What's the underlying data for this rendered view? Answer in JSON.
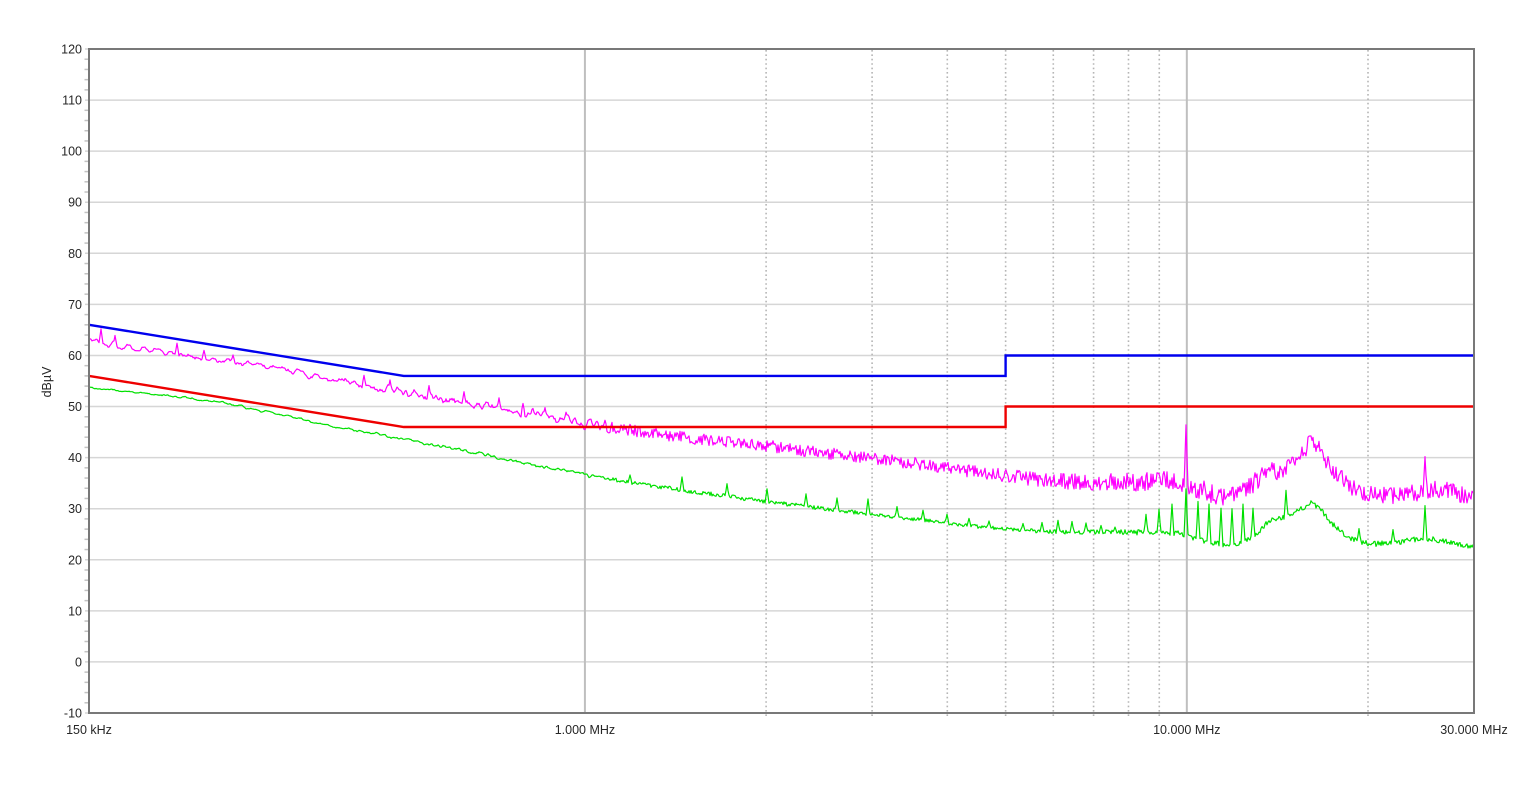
{
  "palette": {
    "background": "#ffffff",
    "plot_background": "#ffffff",
    "axis_border": "#787878",
    "grid_major_horizontal": "#d6d6d6",
    "grid_major_vertical": "#bfbfbf",
    "grid_minor_vertical": "#b5b5b5",
    "minor_tick": "#c3c3c3",
    "tick_text": "#262626",
    "limit_qp": "#0000ee",
    "limit_avg": "#ee0000",
    "trace_peak": "#ff00ff",
    "trace_avg": "#00e000"
  },
  "chart_data": {
    "type": "line",
    "title": "",
    "xlabel": "",
    "ylabel": "dBµV",
    "x_scale": "log",
    "x_unit": "MHz",
    "xlim": [
      0.15,
      30
    ],
    "ylim": [
      -10,
      120
    ],
    "y_major_step": 10,
    "y_minor_step": 2,
    "grid": true,
    "legend": "none",
    "y_ticks": [
      {
        "v": 120,
        "label": "120"
      },
      {
        "v": 110,
        "label": "110"
      },
      {
        "v": 100,
        "label": "100"
      },
      {
        "v": 90,
        "label": "90"
      },
      {
        "v": 80,
        "label": "80"
      },
      {
        "v": 70,
        "label": "70"
      },
      {
        "v": 60,
        "label": "60"
      },
      {
        "v": 50,
        "label": "50"
      },
      {
        "v": 40,
        "label": "40"
      },
      {
        "v": 30,
        "label": "30"
      },
      {
        "v": 20,
        "label": "20"
      },
      {
        "v": 10,
        "label": "10"
      },
      {
        "v": 0,
        "label": "0"
      },
      {
        "v": -10,
        "label": "-10"
      }
    ],
    "x_ticks": [
      {
        "v": 0.15,
        "label": "150 kHz"
      },
      {
        "v": 1,
        "label": "1.000 MHz"
      },
      {
        "v": 10,
        "label": "10.000 MHz"
      },
      {
        "v": 30,
        "label": "30.000 MHz"
      }
    ],
    "x_major_grid": [
      1,
      10
    ],
    "x_minor_grid": [
      2,
      3,
      4,
      5,
      6,
      7,
      8,
      9,
      20
    ],
    "series": [
      {
        "name": "limit-quasi-peak",
        "kind": "limit",
        "color": "#0000ee",
        "width": 2.4,
        "points": [
          [
            0.15,
            66
          ],
          [
            0.5,
            56
          ],
          [
            5,
            56
          ],
          [
            5,
            60
          ],
          [
            30,
            60
          ]
        ]
      },
      {
        "name": "limit-average",
        "kind": "limit",
        "color": "#ee0000",
        "width": 2.4,
        "points": [
          [
            0.15,
            56
          ],
          [
            0.5,
            46
          ],
          [
            5,
            46
          ],
          [
            5,
            50
          ],
          [
            30,
            50
          ]
        ]
      },
      {
        "name": "trace-peak",
        "kind": "noisy-trace",
        "color": "#ff00ff",
        "width": 1.2,
        "seed": 20,
        "baseline": [
          [
            0.15,
            63.3
          ],
          [
            0.16,
            62.3
          ],
          [
            0.18,
            61.3
          ],
          [
            0.2,
            60.6
          ],
          [
            0.23,
            59.6
          ],
          [
            0.26,
            58.8
          ],
          [
            0.3,
            57.6
          ],
          [
            0.34,
            56.4
          ],
          [
            0.4,
            54.8
          ],
          [
            0.45,
            53.8
          ],
          [
            0.5,
            52.8
          ],
          [
            0.6,
            51.2
          ],
          [
            0.7,
            49.9
          ],
          [
            0.8,
            48.7
          ],
          [
            0.9,
            47.6
          ],
          [
            1.0,
            46.6
          ],
          [
            1.2,
            45.3
          ],
          [
            1.5,
            43.8
          ],
          [
            2.0,
            42.2
          ],
          [
            2.5,
            40.9
          ],
          [
            3.0,
            39.9
          ],
          [
            3.5,
            38.9
          ],
          [
            4.0,
            38.0
          ],
          [
            4.5,
            37.2
          ],
          [
            5.0,
            36.5
          ],
          [
            5.5,
            35.9
          ],
          [
            6.0,
            35.4
          ],
          [
            7.0,
            35.2
          ],
          [
            8.0,
            35.3
          ],
          [
            9.0,
            35.5
          ],
          [
            9.8,
            35.2
          ],
          [
            10.5,
            33.8
          ],
          [
            11.0,
            33.0
          ],
          [
            11.6,
            32.4
          ],
          [
            12.2,
            32.8
          ],
          [
            12.8,
            34.5
          ],
          [
            13.4,
            36.8
          ],
          [
            13.9,
            37.4
          ],
          [
            14.3,
            37.2
          ],
          [
            15.0,
            38.8
          ],
          [
            15.6,
            41.0
          ],
          [
            16.1,
            43.3
          ],
          [
            16.6,
            42.0
          ],
          [
            17.2,
            38.8
          ],
          [
            17.8,
            36.5
          ],
          [
            18.5,
            34.8
          ],
          [
            19.5,
            33.5
          ],
          [
            20.5,
            32.9
          ],
          [
            22.0,
            32.6
          ],
          [
            24.0,
            33.2
          ],
          [
            26.0,
            33.8
          ],
          [
            27.5,
            33.3
          ],
          [
            29.0,
            32.8
          ],
          [
            30.0,
            32.2
          ]
        ],
        "noise_amp": [
          [
            0.15,
            0.7
          ],
          [
            0.3,
            0.7
          ],
          [
            0.5,
            0.9
          ],
          [
            1.0,
            1.1
          ],
          [
            2.0,
            1.1
          ],
          [
            4.0,
            1.2
          ],
          [
            6.0,
            1.5
          ],
          [
            8.0,
            1.9
          ],
          [
            12.0,
            1.9
          ],
          [
            16.0,
            1.7
          ],
          [
            30,
            1.8
          ]
        ],
        "spikes": [
          [
            0.157,
            65.2
          ],
          [
            0.166,
            63.9
          ],
          [
            0.21,
            62.4
          ],
          [
            0.233,
            61.0
          ],
          [
            0.26,
            60.1
          ],
          [
            0.43,
            56.1
          ],
          [
            0.475,
            55.2
          ],
          [
            0.55,
            54.1
          ],
          [
            0.63,
            52.9
          ],
          [
            0.72,
            51.7
          ],
          [
            0.79,
            50.6
          ],
          [
            0.86,
            49.8
          ],
          [
            0.93,
            48.9
          ],
          [
            1.08,
            47.3
          ],
          [
            1.19,
            46.5
          ],
          [
            1.31,
            45.7
          ],
          [
            1.46,
            45.0
          ],
          [
            1.62,
            44.3
          ],
          [
            1.8,
            43.7
          ],
          [
            2.05,
            43.3
          ],
          [
            2.35,
            42.3
          ],
          [
            2.62,
            41.6
          ],
          [
            2.95,
            40.8
          ],
          [
            3.3,
            39.8
          ],
          [
            3.65,
            39.0
          ],
          [
            4.0,
            38.6
          ],
          [
            9.95,
            46.4
          ],
          [
            13.0,
            37.0
          ],
          [
            24.85,
            40.2
          ]
        ]
      },
      {
        "name": "trace-average",
        "kind": "noisy-trace",
        "color": "#00e000",
        "width": 1.2,
        "seed": 99,
        "baseline": [
          [
            0.15,
            53.8
          ],
          [
            0.17,
            53.0
          ],
          [
            0.2,
            52.2
          ],
          [
            0.22,
            51.6
          ],
          [
            0.25,
            50.7
          ],
          [
            0.28,
            49.6
          ],
          [
            0.3,
            48.9
          ],
          [
            0.34,
            47.4
          ],
          [
            0.4,
            45.7
          ],
          [
            0.45,
            44.6
          ],
          [
            0.5,
            43.6
          ],
          [
            0.6,
            41.8
          ],
          [
            0.7,
            40.3
          ],
          [
            0.8,
            38.9
          ],
          [
            0.9,
            37.7
          ],
          [
            1.0,
            36.7
          ],
          [
            1.2,
            35.1
          ],
          [
            1.5,
            33.4
          ],
          [
            2.0,
            31.4
          ],
          [
            2.5,
            30.0
          ],
          [
            3.0,
            28.9
          ],
          [
            3.5,
            28.0
          ],
          [
            4.0,
            27.2
          ],
          [
            4.5,
            26.5
          ],
          [
            5.0,
            26.0
          ],
          [
            5.5,
            25.7
          ],
          [
            6.0,
            25.5
          ],
          [
            7.0,
            25.4
          ],
          [
            8.0,
            25.4
          ],
          [
            9.0,
            25.3
          ],
          [
            9.8,
            25.2
          ],
          [
            10.3,
            24.2
          ],
          [
            10.8,
            23.4
          ],
          [
            11.5,
            23.0
          ],
          [
            12.3,
            23.3
          ],
          [
            12.9,
            24.3
          ],
          [
            13.4,
            26.5
          ],
          [
            13.9,
            28.3
          ],
          [
            14.3,
            27.9
          ],
          [
            15.0,
            29.0
          ],
          [
            15.7,
            30.3
          ],
          [
            16.1,
            31.2
          ],
          [
            16.6,
            30.2
          ],
          [
            17.2,
            27.8
          ],
          [
            17.8,
            26.0
          ],
          [
            18.5,
            24.5
          ],
          [
            19.5,
            23.4
          ],
          [
            20.5,
            23.1
          ],
          [
            22.0,
            23.3
          ],
          [
            24.0,
            24.0
          ],
          [
            25.5,
            24.1
          ],
          [
            27.0,
            23.5
          ],
          [
            28.5,
            23.0
          ],
          [
            30.0,
            22.4
          ]
        ],
        "noise_amp": [
          [
            0.15,
            0.25
          ],
          [
            0.5,
            0.35
          ],
          [
            1.0,
            0.4
          ],
          [
            5.0,
            0.35
          ],
          [
            8.0,
            0.5
          ],
          [
            12.0,
            0.55
          ],
          [
            30,
            0.5
          ]
        ],
        "spikes": [
          [
            1.19,
            36.6
          ],
          [
            1.45,
            36.2
          ],
          [
            1.72,
            34.9
          ],
          [
            2.01,
            33.9
          ],
          [
            2.33,
            32.9
          ],
          [
            2.62,
            32.1
          ],
          [
            2.95,
            31.9
          ],
          [
            3.3,
            30.4
          ],
          [
            3.65,
            29.7
          ],
          [
            4.0,
            28.9
          ],
          [
            4.35,
            28.1
          ],
          [
            4.7,
            27.6
          ],
          [
            5.35,
            27.1
          ],
          [
            5.75,
            27.3
          ],
          [
            6.1,
            27.7
          ],
          [
            6.45,
            27.5
          ],
          [
            6.8,
            27.2
          ],
          [
            7.2,
            26.7
          ],
          [
            7.6,
            26.4
          ],
          [
            8.55,
            28.9
          ],
          [
            9.0,
            29.9
          ],
          [
            9.45,
            30.9
          ],
          [
            9.95,
            33.9
          ],
          [
            10.45,
            31.4
          ],
          [
            10.9,
            30.9
          ],
          [
            11.4,
            30.1
          ],
          [
            11.9,
            30.0
          ],
          [
            12.4,
            30.9
          ],
          [
            12.9,
            30.1
          ],
          [
            14.6,
            33.6
          ],
          [
            19.3,
            26.1
          ],
          [
            22.0,
            25.9
          ],
          [
            24.85,
            30.6
          ]
        ]
      }
    ]
  }
}
